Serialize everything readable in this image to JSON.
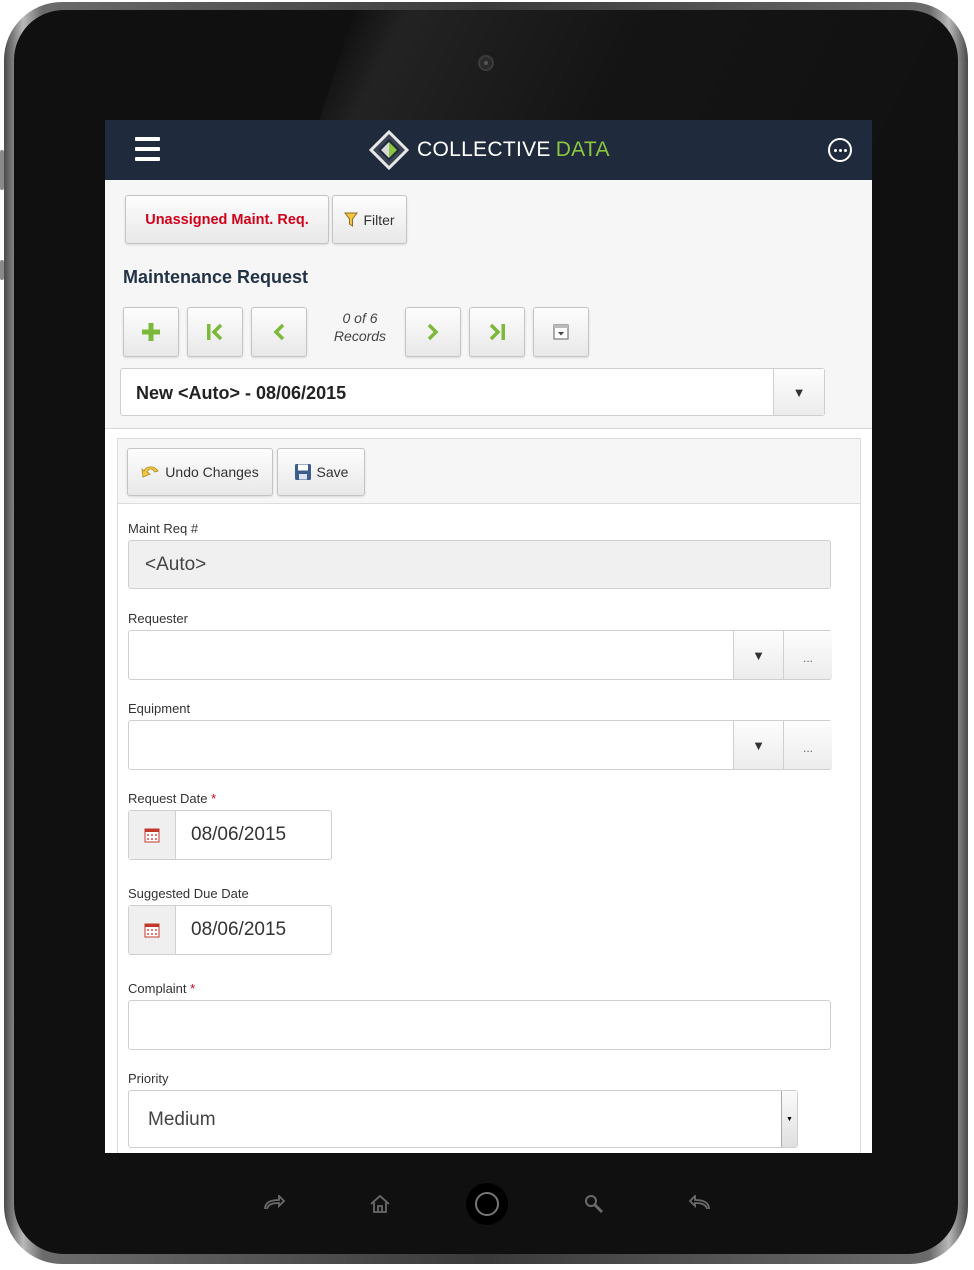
{
  "header": {
    "brand_name_primary": "COLLECTIVE",
    "brand_name_accent": "DATA"
  },
  "colors": {
    "appbar": "#1f2a3c",
    "brand_accent": "#8cc63f",
    "alert_red": "#d0021b",
    "nav_green": "#7cb83a"
  },
  "toolbar": {
    "unassigned_label": "Unassigned Maint. Req.",
    "filter_label": "Filter"
  },
  "page": {
    "title": "Maintenance Request"
  },
  "navigator": {
    "records_count": "0 of 6",
    "records_word": "Records",
    "buttons": [
      {
        "name": "add-record-button",
        "icon": "plus-icon"
      },
      {
        "name": "first-record-button",
        "icon": "first-icon"
      },
      {
        "name": "previous-record-button",
        "icon": "chevron-left-icon"
      },
      {
        "name": "next-record-button",
        "icon": "chevron-right-icon"
      },
      {
        "name": "last-record-button",
        "icon": "last-icon"
      },
      {
        "name": "record-menu-button",
        "icon": "dropdown-box-icon"
      }
    ]
  },
  "record_selector": {
    "value": "New <Auto> - 08/06/2015"
  },
  "form_toolbar": {
    "undo_label": "Undo Changes",
    "save_label": "Save"
  },
  "form": {
    "maint_req": {
      "label": "Maint Req #",
      "value": "<Auto>"
    },
    "requester": {
      "label": "Requester",
      "value": "",
      "more": "..."
    },
    "equipment": {
      "label": "Equipment",
      "value": "",
      "more": "..."
    },
    "request_date": {
      "label": "Request Date",
      "required_mark": "*",
      "value": "08/06/2015"
    },
    "suggested_due_date": {
      "label": "Suggested Due Date",
      "value": "08/06/2015"
    },
    "complaint": {
      "label": "Complaint",
      "required_mark": "*",
      "value": ""
    },
    "priority": {
      "label": "Priority",
      "value": "Medium"
    }
  },
  "device_nav": [
    "forward-icon",
    "home-icon",
    "home-button",
    "search-icon",
    "back-icon"
  ]
}
